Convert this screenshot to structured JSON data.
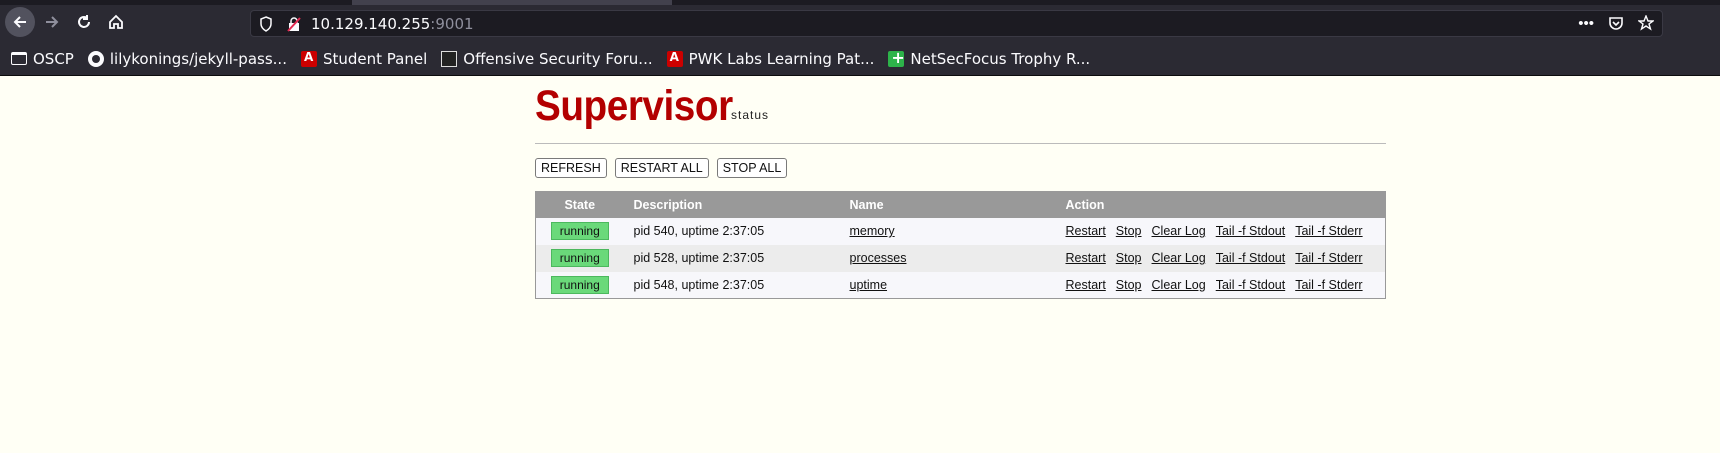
{
  "browser": {
    "url_host": "10.129.140.255",
    "url_port": ":9001",
    "bookmarks": [
      {
        "label": "OSCP",
        "icon": "folder-icon"
      },
      {
        "label": "lilykonings/jekyll-pass...",
        "icon": "github-icon"
      },
      {
        "label": "Student Panel",
        "icon": "offsec-icon"
      },
      {
        "label": "Offensive Security Foru...",
        "icon": "forum-icon"
      },
      {
        "label": "PWK Labs Learning Pat...",
        "icon": "offsec-icon"
      },
      {
        "label": "NetSecFocus Trophy R...",
        "icon": "sheets-icon"
      }
    ]
  },
  "header": {
    "logo": "Supervisor",
    "subtitle": "status"
  },
  "actions": {
    "refresh": "REFRESH",
    "restart_all": "RESTART ALL",
    "stop_all": "STOP ALL"
  },
  "table": {
    "columns": [
      "State",
      "Description",
      "Name",
      "Action"
    ],
    "rows": [
      {
        "state": "running",
        "description": "pid 540, uptime 2:37:05",
        "name": "memory"
      },
      {
        "state": "running",
        "description": "pid 528, uptime 2:37:05",
        "name": "processes"
      },
      {
        "state": "running",
        "description": "pid 548, uptime 2:37:05",
        "name": "uptime"
      }
    ],
    "row_actions": [
      "Restart",
      "Stop",
      "Clear Log",
      "Tail -f Stdout",
      "Tail -f Stderr"
    ]
  },
  "colors": {
    "logo": "#b30000",
    "running_badge": "#6ad97a",
    "table_header": "#999999"
  }
}
